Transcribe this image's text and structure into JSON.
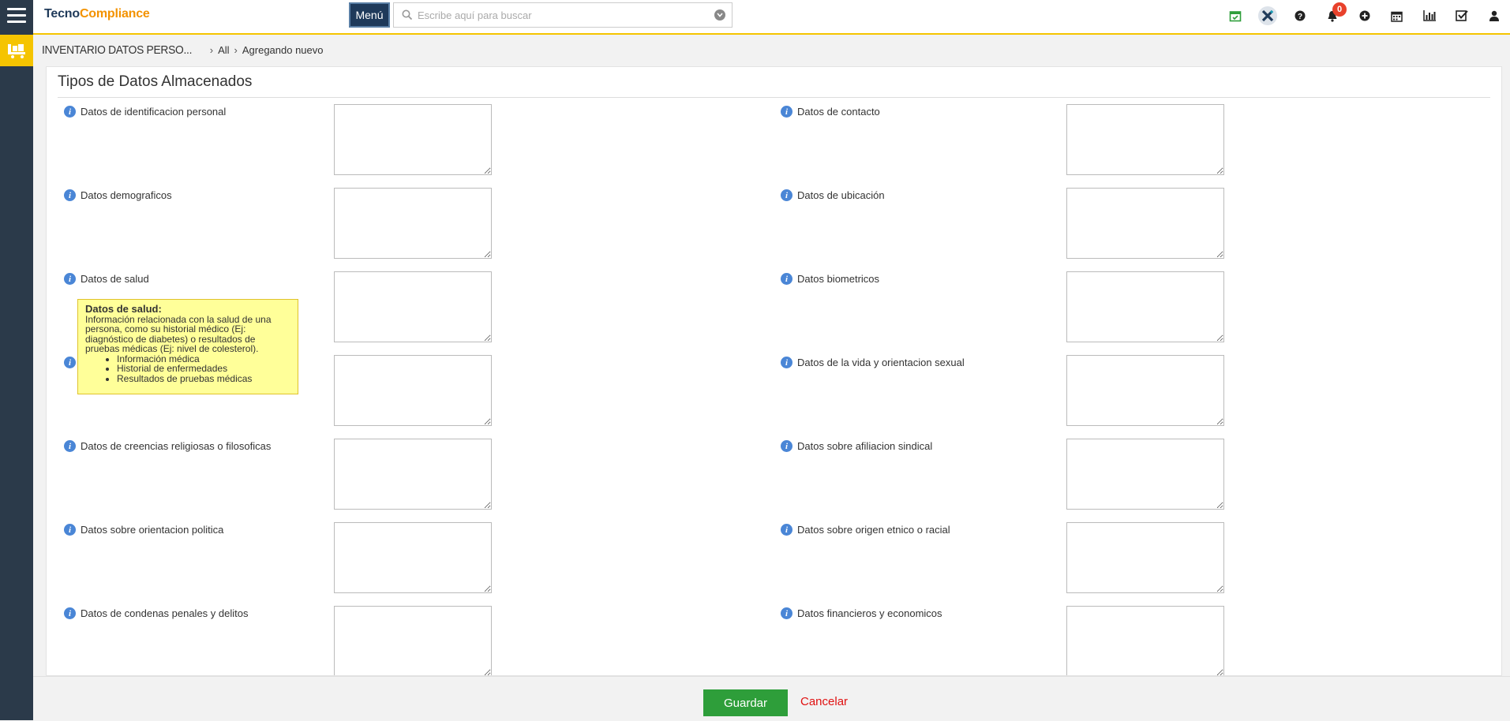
{
  "app": {
    "logo_part1": "Tecno",
    "logo_part2": "Compliance"
  },
  "header": {
    "menu_label": "Menú",
    "search_placeholder": "Escribe aquí para buscar",
    "notifications_count": "0",
    "icons": [
      "calendar-check-icon",
      "x-logo-icon",
      "help-icon",
      "bell-icon",
      "plus-circle-icon",
      "calendar-icon",
      "bar-chart-icon",
      "checkbox-icon",
      "user-icon"
    ]
  },
  "breadcrumb": {
    "module": "INVENTARIO DATOS PERSO...",
    "level1": "All",
    "level2": "Agregando nuevo"
  },
  "section": {
    "title": "Tipos de Datos Almacenados"
  },
  "fields_left": [
    {
      "label": "Datos de identificacion personal",
      "value": ""
    },
    {
      "label": "Datos demograficos",
      "value": ""
    },
    {
      "label": "Datos de salud",
      "value": ""
    },
    {
      "label": "",
      "value": ""
    },
    {
      "label": "Datos de creencias religiosas o filosoficas",
      "value": ""
    },
    {
      "label": "Datos sobre orientacion politica",
      "value": ""
    },
    {
      "label": "Datos de condenas penales y delitos",
      "value": ""
    }
  ],
  "fields_right": [
    {
      "label": "Datos de contacto",
      "value": ""
    },
    {
      "label": "Datos de ubicación",
      "value": ""
    },
    {
      "label": "Datos biometricos",
      "value": ""
    },
    {
      "label": "Datos de la vida y orientacion sexual",
      "value": ""
    },
    {
      "label": "Datos sobre afiliacion sindical",
      "value": ""
    },
    {
      "label": "Datos sobre origen etnico o racial",
      "value": ""
    },
    {
      "label": "Datos financieros y economicos",
      "value": ""
    }
  ],
  "tooltip": {
    "title": "Datos de salud:",
    "text": "Información relacionada con la salud de una persona, como su historial médico (Ej: diagnóstico de diabetes) o resultados de pruebas médicas (Ej: nivel de colesterol).",
    "items": [
      "Información médica",
      "Historial de enfermedades",
      "Resultados de pruebas médicas"
    ]
  },
  "footer": {
    "save_label": "Guardar",
    "cancel_label": "Cancelar"
  },
  "colors": {
    "accent": "#f5c400",
    "rail": "#2b3a4a",
    "save": "#2e9e3a",
    "cancel": "#e01010",
    "badge": "#e8412b"
  }
}
